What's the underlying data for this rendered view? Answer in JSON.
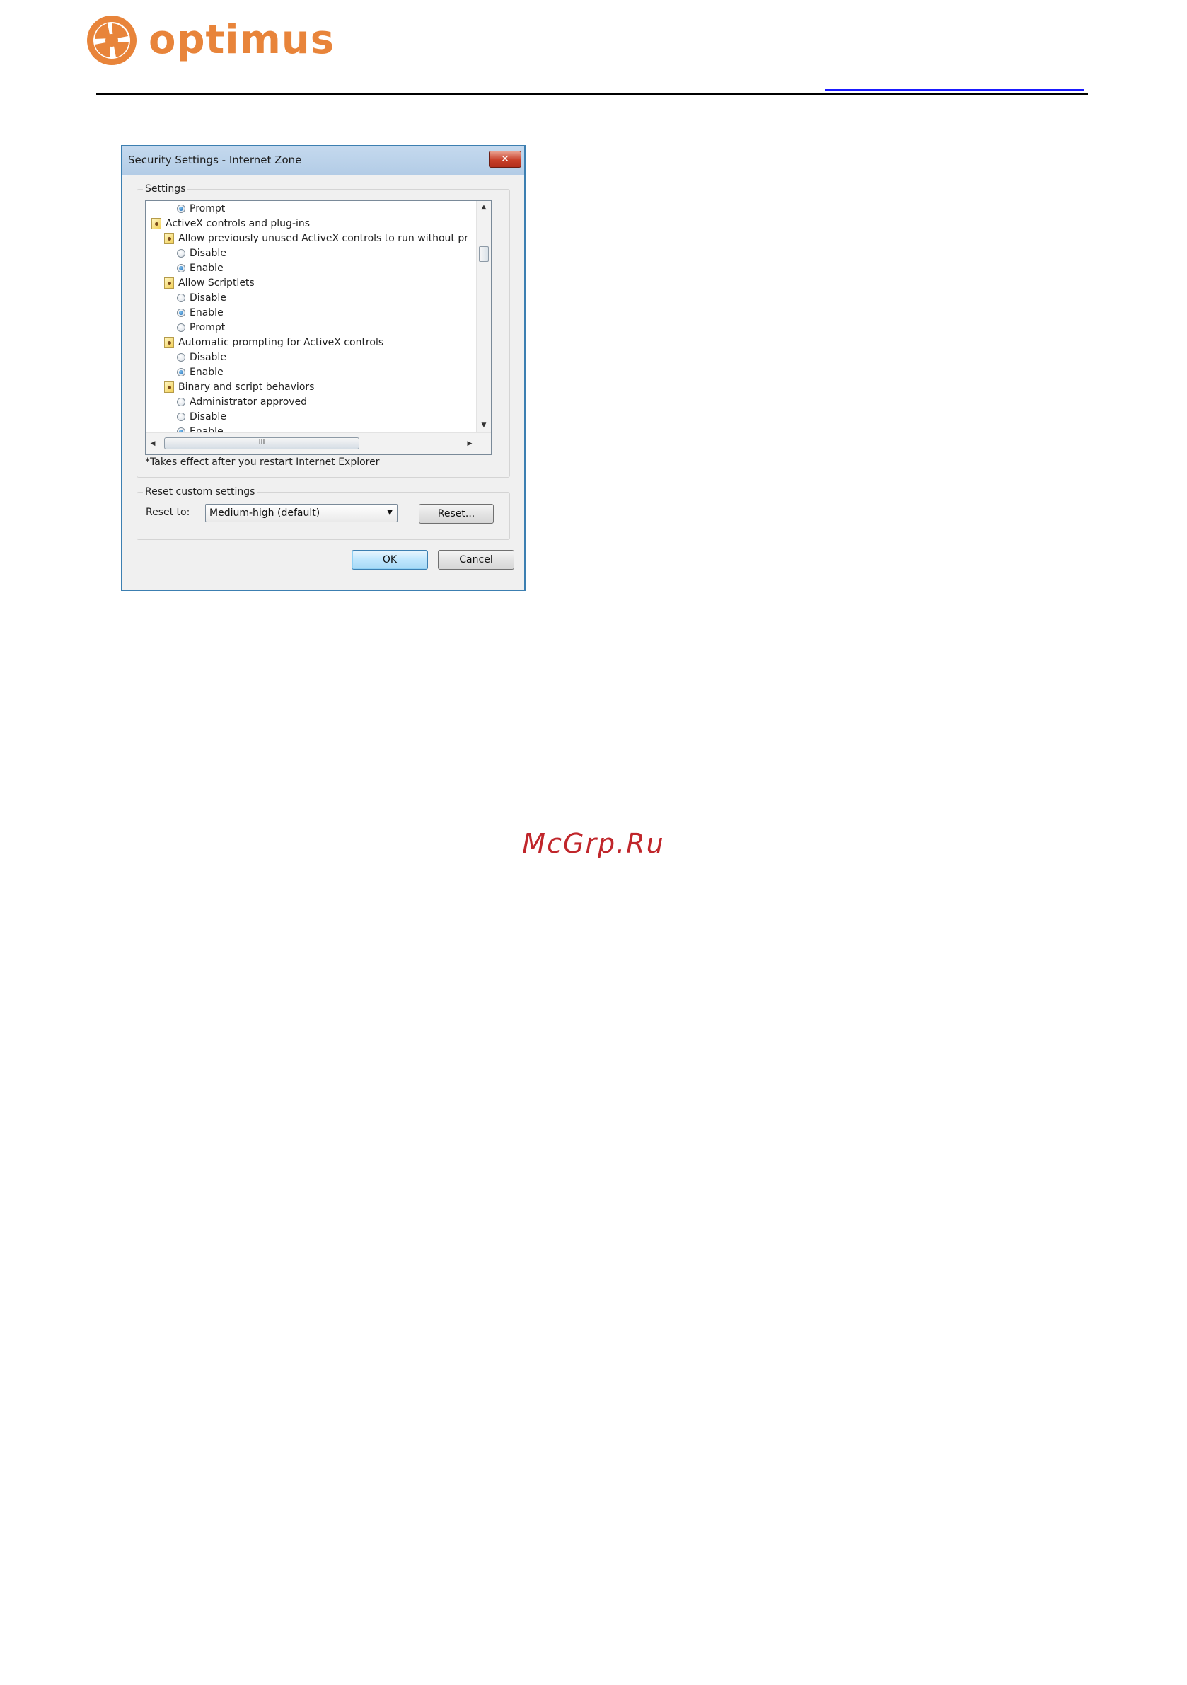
{
  "header": {
    "brand": "optimus",
    "brand_color": "#e8843a"
  },
  "dialog": {
    "title": "Security Settings - Internet Zone",
    "close_label": "✕",
    "settings_group_label": "Settings",
    "tree": [
      {
        "type": "radio",
        "label": "Prompt",
        "checked": true,
        "indent": 2
      },
      {
        "type": "category",
        "label": "ActiveX controls and plug-ins",
        "indent": 0
      },
      {
        "type": "category",
        "label": "Allow previously unused ActiveX controls to run without prom",
        "indent": 1
      },
      {
        "type": "radio",
        "label": "Disable",
        "checked": false,
        "indent": 2
      },
      {
        "type": "radio",
        "label": "Enable",
        "checked": true,
        "indent": 2
      },
      {
        "type": "category",
        "label": "Allow Scriptlets",
        "indent": 1
      },
      {
        "type": "radio",
        "label": "Disable",
        "checked": false,
        "indent": 2
      },
      {
        "type": "radio",
        "label": "Enable",
        "checked": true,
        "indent": 2
      },
      {
        "type": "radio",
        "label": "Prompt",
        "checked": false,
        "indent": 2
      },
      {
        "type": "category",
        "label": "Automatic prompting for ActiveX controls",
        "indent": 1
      },
      {
        "type": "radio",
        "label": "Disable",
        "checked": false,
        "indent": 2
      },
      {
        "type": "radio",
        "label": "Enable",
        "checked": true,
        "indent": 2
      },
      {
        "type": "category",
        "label": "Binary and script behaviors",
        "indent": 1
      },
      {
        "type": "radio",
        "label": "Administrator approved",
        "checked": false,
        "indent": 2
      },
      {
        "type": "radio",
        "label": "Disable",
        "checked": false,
        "indent": 2
      },
      {
        "type": "radio",
        "label": "Enable",
        "checked": true,
        "indent": 2
      }
    ],
    "hscroll_grip": "III",
    "note": "*Takes effect after you restart Internet Explorer",
    "reset_group_label": "Reset custom settings",
    "reset_to_label": "Reset to:",
    "reset_level": "Medium-high (default)",
    "reset_button": "Reset...",
    "ok_button": "OK",
    "cancel_button": "Cancel"
  },
  "watermark": "McGrp.Ru"
}
